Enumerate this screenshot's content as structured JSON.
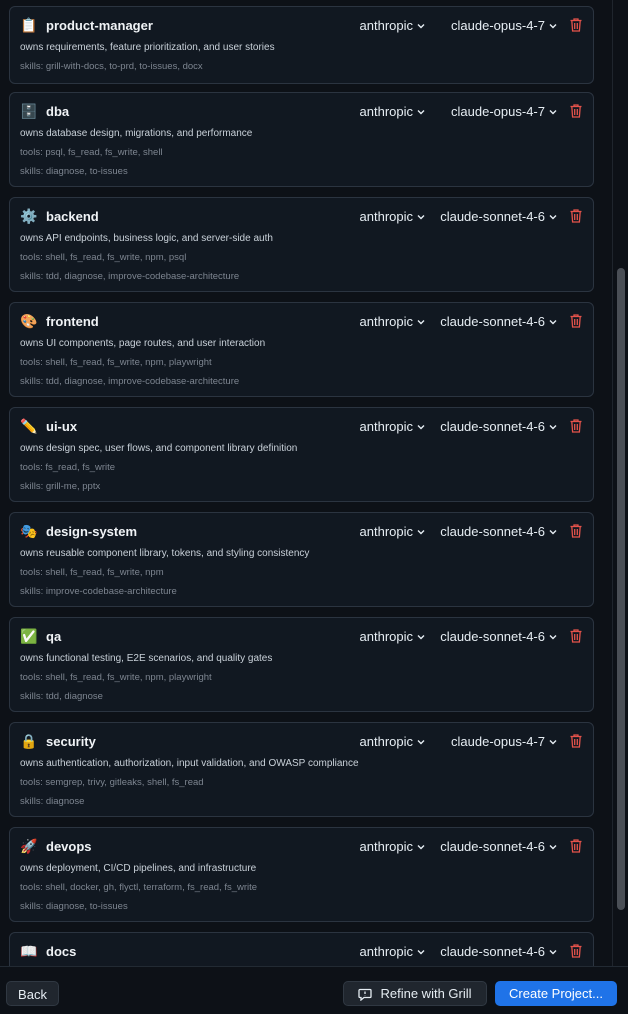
{
  "agents": [
    {
      "icon": "📋",
      "icon_name": "clipboard-icon",
      "name": "product-manager",
      "provider": "anthropic",
      "model": "claude-opus-4-7",
      "description": "owns requirements, feature prioritization, and user stories",
      "tools": null,
      "skills": "skills: grill-with-docs, to-prd, to-issues, docx"
    },
    {
      "icon": "🗄️",
      "icon_name": "file-cabinet-icon",
      "name": "dba",
      "provider": "anthropic",
      "model": "claude-opus-4-7",
      "description": "owns database design, migrations, and performance",
      "tools": "tools: psql, fs_read, fs_write, shell",
      "skills": "skills: diagnose, to-issues"
    },
    {
      "icon": "⚙️",
      "icon_name": "gear-icon",
      "name": "backend",
      "provider": "anthropic",
      "model": "claude-sonnet-4-6",
      "description": "owns API endpoints, business logic, and server-side auth",
      "tools": "tools: shell, fs_read, fs_write, npm, psql",
      "skills": "skills: tdd, diagnose, improve-codebase-architecture"
    },
    {
      "icon": "🎨",
      "icon_name": "palette-icon",
      "name": "frontend",
      "provider": "anthropic",
      "model": "claude-sonnet-4-6",
      "description": "owns UI components, page routes, and user interaction",
      "tools": "tools: shell, fs_read, fs_write, npm, playwright",
      "skills": "skills: tdd, diagnose, improve-codebase-architecture"
    },
    {
      "icon": "✏️",
      "icon_name": "pencil-icon",
      "name": "ui-ux",
      "provider": "anthropic",
      "model": "claude-sonnet-4-6",
      "description": "owns design spec, user flows, and component library definition",
      "tools": "tools: fs_read, fs_write",
      "skills": "skills: grill-me, pptx"
    },
    {
      "icon": "🎭",
      "icon_name": "masks-icon",
      "name": "design-system",
      "provider": "anthropic",
      "model": "claude-sonnet-4-6",
      "description": "owns reusable component library, tokens, and styling consistency",
      "tools": "tools: shell, fs_read, fs_write, npm",
      "skills": "skills: improve-codebase-architecture"
    },
    {
      "icon": "✅",
      "icon_name": "check-mark-icon",
      "name": "qa",
      "provider": "anthropic",
      "model": "claude-sonnet-4-6",
      "description": "owns functional testing, E2E scenarios, and quality gates",
      "tools": "tools: shell, fs_read, fs_write, npm, playwright",
      "skills": "skills: tdd, diagnose"
    },
    {
      "icon": "🔒",
      "icon_name": "lock-icon",
      "name": "security",
      "provider": "anthropic",
      "model": "claude-opus-4-7",
      "description": "owns authentication, authorization, input validation, and OWASP compliance",
      "tools": "tools: semgrep, trivy, gitleaks, shell, fs_read",
      "skills": "skills: diagnose"
    },
    {
      "icon": "🚀",
      "icon_name": "rocket-icon",
      "name": "devops",
      "provider": "anthropic",
      "model": "claude-sonnet-4-6",
      "description": "owns deployment, CI/CD pipelines, and infrastructure",
      "tools": "tools: shell, docker, gh, flyctl, terraform, fs_read, fs_write",
      "skills": "skills: diagnose, to-issues"
    },
    {
      "icon": "📖",
      "icon_name": "book-icon",
      "name": "docs",
      "provider": "anthropic",
      "model": "claude-sonnet-4-6",
      "description": "",
      "tools": null,
      "skills": null
    }
  ],
  "footer": {
    "back_label": "Back",
    "refine_label": "Refine with Grill",
    "create_label": "Create Project..."
  },
  "colors": {
    "accent": "#1f73e8",
    "trash": "#e5534b"
  }
}
